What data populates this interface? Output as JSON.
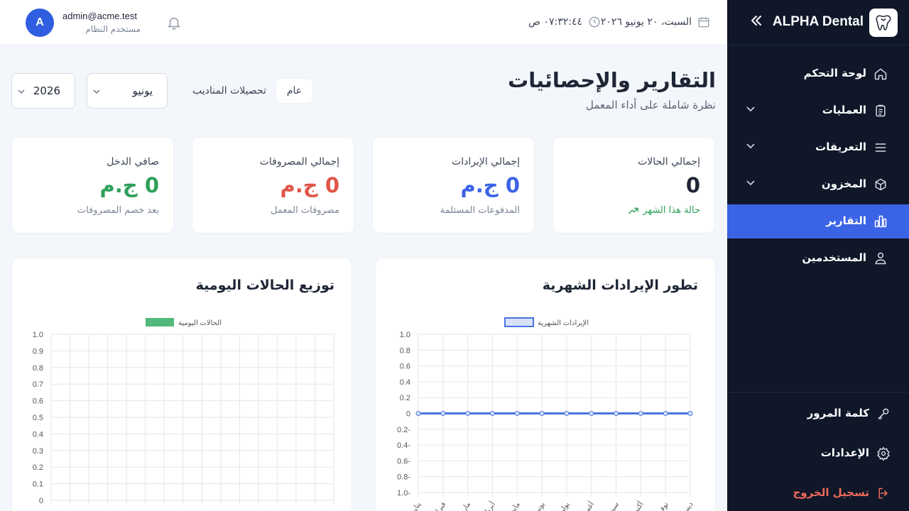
{
  "sidebar": {
    "brand": "ALPHA Dental",
    "items": [
      {
        "label": "لوحة التحكم",
        "icon": "home-icon",
        "chevron": false,
        "active": false
      },
      {
        "label": "العمليات",
        "icon": "clipboard-icon",
        "chevron": true,
        "active": false
      },
      {
        "label": "التعريفات",
        "icon": "list-icon",
        "chevron": true,
        "active": false
      },
      {
        "label": "المخزون",
        "icon": "box-icon",
        "chevron": true,
        "active": false
      },
      {
        "label": "التقارير",
        "icon": "bar-chart-icon",
        "chevron": false,
        "active": true
      },
      {
        "label": "المستخدمين",
        "icon": "users-icon",
        "chevron": false,
        "active": false
      }
    ],
    "bottom": [
      {
        "label": "كلمة المرور",
        "icon": "key-icon"
      },
      {
        "label": "الإعدادات",
        "icon": "gear-icon"
      },
      {
        "label": "تسجيل الخروج",
        "icon": "logout-icon"
      }
    ]
  },
  "topbar": {
    "date": "السبت، ٢٠ يونيو ٢٠٢٦",
    "time": "٠٧:٣٢:٤٤ ص",
    "user_initial": "A",
    "user_email": "admin@acme.test",
    "user_role": "مستخدم النظام"
  },
  "header": {
    "title": "التقارير والإحصائيات",
    "subtitle": "نظرة شاملة على أداء المعمل",
    "filter_general": "عام",
    "filter_reps": "تحصيلات المناديب",
    "month": "يونيو",
    "year": "2026"
  },
  "stats": [
    {
      "title": "إجمالي الحالات",
      "value": "0",
      "sub": "حالة هذا الشهر",
      "color": "#1e2535"
    },
    {
      "title": "إجمالي الإيرادات",
      "value": "0 ج.م",
      "sub": "المدفوعات المستلمة",
      "color": "#3b63e6"
    },
    {
      "title": "إجمالي المصروفات",
      "value": "0 ج.م",
      "sub": "مصروفات المعمل",
      "color": "#e05548"
    },
    {
      "title": "صافي الدخل",
      "value": "0 ج.م",
      "sub": "بعد خصم المصروفات",
      "color": "#2ea05a"
    }
  ],
  "panels": {
    "revenue_title": "تطور الإيرادات الشهرية",
    "daily_title": "توزيع الحالات اليومية"
  },
  "chart_data": [
    {
      "type": "line",
      "title": "تطور الإيرادات الشهرية",
      "legend": "top",
      "series": [
        {
          "name": "الإيرادات الشهرية",
          "color": "#4a74e0",
          "values": [
            0,
            0,
            0,
            0,
            0,
            0,
            0,
            0,
            0,
            0,
            0,
            0
          ]
        }
      ],
      "categories": [
        "يناير",
        "فبراير",
        "مارس",
        "أبريل",
        "مايو",
        "يونيو",
        "يوليو",
        "أغسطس",
        "سبتمبر",
        "أكتوبر",
        "نوفمبر",
        "ديسمبر"
      ],
      "yticks": [
        "1.0",
        "0.8",
        "0.6",
        "0.4",
        "0.2",
        "0",
        "0.2-",
        "0.4-",
        "0.6-",
        "0.8-",
        "1.0-"
      ],
      "ylim": [
        -1.0,
        1.0
      ],
      "grid": true
    },
    {
      "type": "bar",
      "title": "توزيع الحالات اليومية",
      "legend": "top",
      "series": [
        {
          "name": "الحالات اليومية",
          "color": "#52b97a",
          "values": []
        }
      ],
      "yticks": [
        "1.0",
        "0.9",
        "0.8",
        "0.7",
        "0.6",
        "0.5",
        "0.4",
        "0.3",
        "0.2",
        "0.1",
        "0"
      ],
      "ylim": [
        0,
        1.0
      ],
      "grid": true
    }
  ]
}
